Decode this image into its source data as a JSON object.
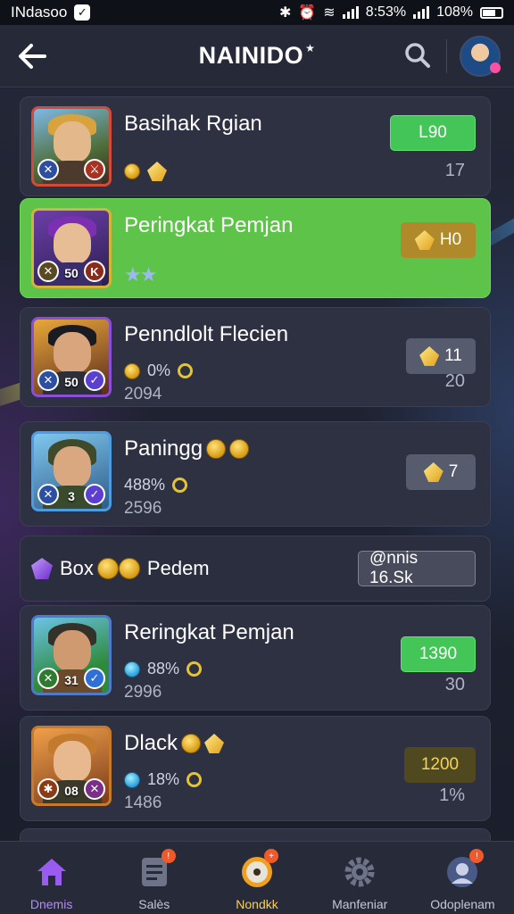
{
  "status_bar": {
    "carrier": "INdasoo",
    "time": "8:53%",
    "battery": "108%"
  },
  "header": {
    "title": "NAINIDO"
  },
  "cards": [
    {
      "title": "Basihak Rgian",
      "stat": "",
      "sub": "",
      "pill": "L90",
      "count": "17",
      "highlight": false
    },
    {
      "title": "Peringkat Pemjan",
      "thumb_num": "50",
      "stat": "",
      "sub": "",
      "pill": "H0",
      "count": "",
      "highlight": true
    },
    {
      "title": "Penndlolt Flecien",
      "thumb_num": "50",
      "stat": "0%",
      "sub": "2094",
      "pill": "11",
      "count": "20",
      "highlight": false
    },
    {
      "title": "Paningg",
      "thumb_num": "3",
      "stat": "488%",
      "sub": "2596",
      "pill": "7",
      "count": "",
      "highlight": false
    },
    {
      "title": "Reringkat Pemjan",
      "thumb_num": "31",
      "stat": "88%",
      "sub": "2996",
      "pill": "1390",
      "count": "30",
      "highlight": false
    },
    {
      "title": "Dlack",
      "thumb_num": "08",
      "stat": "18%",
      "sub": "1486",
      "pill": "1200",
      "count": "1%",
      "highlight": false
    }
  ],
  "promo": {
    "label": "Box",
    "label2": "Pedem",
    "pill": "@nnis 16.Sk"
  },
  "nav": [
    {
      "label": "Dnemis",
      "icon": "home-icon"
    },
    {
      "label": "Salès",
      "icon": "document-icon"
    },
    {
      "label": "Nondkk",
      "icon": "target-icon"
    },
    {
      "label": "Manfeniar",
      "icon": "gear-icon"
    },
    {
      "label": "Odoplenam",
      "icon": "avatar-icon"
    }
  ],
  "colors": {
    "accent_green": "#5ec449",
    "nav_active": "#b887ff"
  }
}
